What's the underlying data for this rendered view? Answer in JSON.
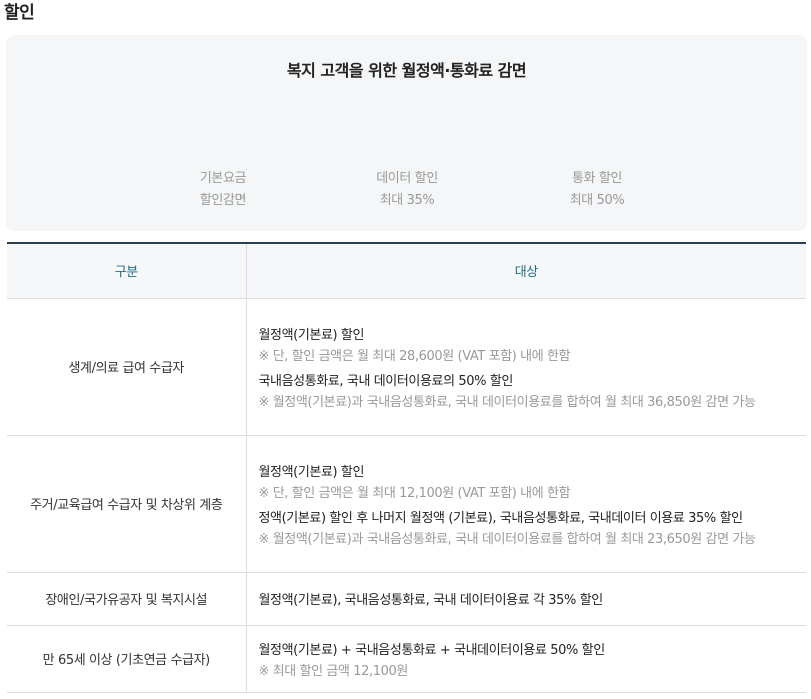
{
  "page": {
    "title": "할인"
  },
  "summary": {
    "title": "복지 고객을 위한 월정액·통화료 감면",
    "benefits": [
      {
        "line1": "기본요금",
        "line2": "할인감면"
      },
      {
        "line1": "데이터 할인",
        "line2": "최대 35%"
      },
      {
        "line1": "통화 할인",
        "line2": "최대 50%"
      }
    ]
  },
  "table": {
    "headers": {
      "category": "구분",
      "target": "대상"
    },
    "rows": [
      {
        "category": "생계/의료 급여 수급자",
        "lines": [
          {
            "text": "월정액(기본료) 할인",
            "kind": "main"
          },
          {
            "text": "※ 단, 할인 금액은 월 최대 28,600원 (VAT 포함) 내에 한함",
            "kind": "note"
          },
          {
            "text": "국내음성통화료, 국내 데이터이용료의 50% 할인",
            "kind": "main"
          },
          {
            "text": "※ 월정액(기본료)과 국내음성통화료, 국내 데이터이용료를 합하여 월 최대 36,850원 감면 가능",
            "kind": "note"
          }
        ]
      },
      {
        "category": "주거/교육급여 수급자 및 차상위 계층",
        "lines": [
          {
            "text": "월정액(기본료) 할인",
            "kind": "main"
          },
          {
            "text": "※ 단, 할인 금액은 월 최대 12,100원 (VAT 포함) 내에 한함",
            "kind": "note"
          },
          {
            "text": "정액(기본료) 할인 후 나머지 월정액 (기본료), 국내음성통화료, 국내데이터 이용료 35% 할인",
            "kind": "main"
          },
          {
            "text": "※ 월정액(기본료)과 국내음성통화료, 국내 데이터이용료를 합하여 월 최대 23,650원 감면 가능",
            "kind": "note"
          }
        ]
      },
      {
        "category": "장애인/국가유공자 및 복지시설",
        "lines": [
          {
            "text": "월정액(기본료), 국내음성통화료, 국내 데이터이용료 각 35% 할인",
            "kind": "main"
          }
        ]
      },
      {
        "category": "만 65세 이상 (기초연금 수급자)",
        "lines": [
          {
            "text": "월정액(기본료) + 국내음성통화료 + 국내데이터이용료 50% 할인",
            "kind": "main"
          },
          {
            "text": "※ 최대 할인 금액 12,100원",
            "kind": "note"
          }
        ]
      }
    ]
  }
}
